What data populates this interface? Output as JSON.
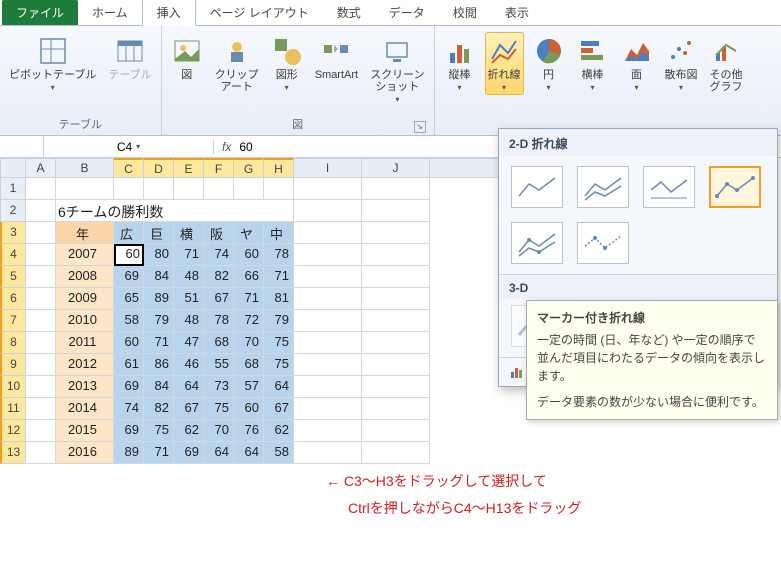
{
  "tabs": {
    "file": "ファイル",
    "home": "ホーム",
    "insert": "挿入",
    "pagelayout": "ページ レイアウト",
    "formulas": "数式",
    "data": "データ",
    "review": "校閲",
    "view": "表示"
  },
  "ribbon": {
    "groups": {
      "tables": {
        "title": "テーブル",
        "pivot": "ピボットテーブル",
        "table": "テーブル"
      },
      "illust": {
        "title": "図",
        "picture": "図",
        "clipart": "クリップ\nアート",
        "shapes": "図形",
        "smartart": "SmartArt",
        "screenshot": "スクリーン\nショット"
      },
      "charts": {
        "column": "縦棒",
        "line": "折れ線",
        "pie": "円",
        "bar": "横棒",
        "area": "面",
        "scatter": "散布図",
        "other": "その他\nグラフ"
      }
    }
  },
  "namebox": "C4",
  "fx_value": "60",
  "sheet": {
    "title": "6チームの勝利数",
    "headers": [
      "年",
      "広",
      "巨",
      "横",
      "阪",
      "ヤ",
      "中"
    ],
    "rows": [
      {
        "year": "2007",
        "v": [
          "60",
          "80",
          "71",
          "74",
          "60",
          "78"
        ]
      },
      {
        "year": "2008",
        "v": [
          "69",
          "84",
          "48",
          "82",
          "66",
          "71"
        ]
      },
      {
        "year": "2009",
        "v": [
          "65",
          "89",
          "51",
          "67",
          "71",
          "81"
        ]
      },
      {
        "year": "2010",
        "v": [
          "58",
          "79",
          "48",
          "78",
          "72",
          "79"
        ]
      },
      {
        "year": "2011",
        "v": [
          "60",
          "71",
          "47",
          "68",
          "70",
          "75"
        ]
      },
      {
        "year": "2012",
        "v": [
          "61",
          "86",
          "46",
          "55",
          "68",
          "75"
        ]
      },
      {
        "year": "2013",
        "v": [
          "69",
          "84",
          "64",
          "73",
          "57",
          "64"
        ]
      },
      {
        "year": "2014",
        "v": [
          "74",
          "82",
          "67",
          "75",
          "60",
          "67"
        ]
      },
      {
        "year": "2015",
        "v": [
          "69",
          "75",
          "62",
          "70",
          "76",
          "62"
        ]
      },
      {
        "year": "2016",
        "v": [
          "89",
          "71",
          "69",
          "64",
          "64",
          "58"
        ]
      }
    ]
  },
  "chart_panel": {
    "section_2d": "2-D 折れ線",
    "section_3d": "3-D"
  },
  "tooltip": {
    "title": "マーカー付き折れ線",
    "body1": "一定の時間 (日、年など) や一定の順序で並んだ項目にわたるデータの傾向を表示します。",
    "body2": "データ要素の数が少ない場合に便利です。"
  },
  "annotation": {
    "line1": "← C3〜H3をドラッグして選択して",
    "line2": "Ctrlを押しながらC4〜H13をドラッグ"
  }
}
